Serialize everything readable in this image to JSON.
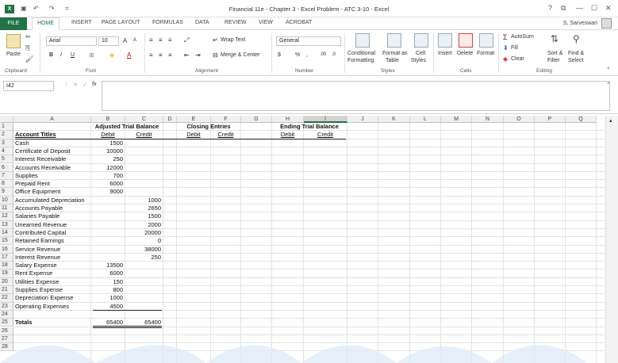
{
  "window": {
    "title": "Financial 11e - Chapter 3 - Excel Problem - ATC 3-10 - Excel",
    "help": "?",
    "restore": "⧉",
    "minimize": "—",
    "maximize": "☐",
    "close": "✕"
  },
  "qat": {
    "save": "💾",
    "undo": "↶",
    "redo": "↷",
    "customize": "="
  },
  "tabs": {
    "file": "FILE",
    "items": [
      "HOME",
      "INSERT",
      "PAGE LAYOUT",
      "FORMULAS",
      "DATA",
      "REVIEW",
      "VIEW",
      "ACROBAT"
    ],
    "active": "HOME",
    "user": "S, Sarveswari"
  },
  "ribbon": {
    "clipboard": {
      "paste": "Paste",
      "label": "Clipboard"
    },
    "font": {
      "name": "Arial",
      "size": "10",
      "grow": "A",
      "shrink": "A",
      "bold": "B",
      "italic": "I",
      "underline": "U",
      "label": "Font"
    },
    "alignment": {
      "wrap": "Wrap Text",
      "merge": "Merge & Center",
      "label": "Alignment"
    },
    "number": {
      "format": "General",
      "currency": "$",
      "percent": "%",
      "comma": ",",
      "inc": ".00",
      "dec": ".0",
      "label": "Number"
    },
    "styles": {
      "conditional": "Conditional",
      "conditional2": "Formatting",
      "format_as": "Format as",
      "format_as2": "Table",
      "cell": "Cell",
      "cell2": "Styles",
      "label": "Styles"
    },
    "cells": {
      "insert": "Insert",
      "delete": "Delete",
      "format": "Format",
      "label": "Cells"
    },
    "editing": {
      "autosum": "AutoSum",
      "fill": "Fill",
      "clear": "Clear",
      "sort": "Sort &",
      "sort2": "Filter",
      "find": "Find &",
      "find2": "Select",
      "label": "Editing"
    }
  },
  "formula_bar": {
    "name_box": "I42",
    "cancel": "✕",
    "enter": "✓",
    "fx": "fx",
    "value": ""
  },
  "columns": [
    "A",
    "B",
    "C",
    "D",
    "E",
    "F",
    "G",
    "H",
    "I",
    "J",
    "K",
    "L",
    "M",
    "N",
    "O",
    "P",
    "Q"
  ],
  "selected_column": "I",
  "sheet": {
    "group_headers": {
      "adjusted": "Adjusted Trial Balance",
      "closing": "Closing Entries",
      "ending": "Ending Trial Balance"
    },
    "sub_headers": {
      "account": "Account Titles",
      "debit": "Debit",
      "credit": "Credit"
    },
    "rows": [
      {
        "title": "Cash",
        "debit": "1500",
        "credit": ""
      },
      {
        "title": "Certificate of Deposit",
        "debit": "10000",
        "credit": ""
      },
      {
        "title": "Interest Receivable",
        "debit": "250",
        "credit": ""
      },
      {
        "title": "Accounts Receivable",
        "debit": "12000",
        "credit": ""
      },
      {
        "title": "Supplies",
        "debit": "700",
        "credit": ""
      },
      {
        "title": "Prepaid Rent",
        "debit": "6000",
        "credit": ""
      },
      {
        "title": "Office Equipment",
        "debit": "9000",
        "credit": ""
      },
      {
        "title": "Accumulated Depreciation",
        "debit": "",
        "credit": "1000"
      },
      {
        "title": "Accounts Payable",
        "debit": "",
        "credit": "2650"
      },
      {
        "title": "Salaries Payable",
        "debit": "",
        "credit": "1500"
      },
      {
        "title": "Unearned Revenue",
        "debit": "",
        "credit": "2000"
      },
      {
        "title": "Contributed Capital",
        "debit": "",
        "credit": "20000"
      },
      {
        "title": "Retained Earnings",
        "debit": "",
        "credit": "0"
      },
      {
        "title": "Service Revenue",
        "debit": "",
        "credit": "38000"
      },
      {
        "title": "Interest Revenue",
        "debit": "",
        "credit": "250"
      },
      {
        "title": "Salary Expense",
        "debit": "13500",
        "credit": ""
      },
      {
        "title": "Rent Expense",
        "debit": "6000",
        "credit": ""
      },
      {
        "title": "Utilities Expense",
        "debit": "150",
        "credit": ""
      },
      {
        "title": "Supplies Expense",
        "debit": "800",
        "credit": ""
      },
      {
        "title": "Depreciation Expense",
        "debit": "1000",
        "credit": ""
      },
      {
        "title": "Operating Expenses",
        "debit": "4500",
        "credit": ""
      }
    ],
    "totals": {
      "label": "Totals",
      "debit": "65400",
      "credit": "65400"
    },
    "row_numbers": [
      "1",
      "2",
      "3",
      "4",
      "5",
      "6",
      "7",
      "8",
      "9",
      "10",
      "11",
      "12",
      "13",
      "14",
      "15",
      "16",
      "17",
      "18",
      "19",
      "20",
      "21",
      "22",
      "23",
      "24",
      "25",
      "26",
      "27",
      "28"
    ]
  }
}
